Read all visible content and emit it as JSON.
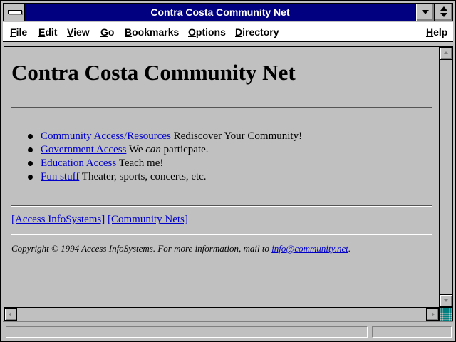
{
  "window": {
    "title": "Contra Costa Community Net"
  },
  "menubar": {
    "items": [
      "File",
      "Edit",
      "View",
      "Go",
      "Bookmarks",
      "Options",
      "Directory"
    ],
    "help": "Help"
  },
  "page": {
    "heading": "Contra Costa Community Net",
    "list": [
      {
        "link": "Community Access/Resources",
        "text_before_em": " Rediscover Your Community!",
        "em": "",
        "text_after_em": ""
      },
      {
        "link": "Government Access",
        "text_before_em": " We ",
        "em": "can",
        "text_after_em": " particpate."
      },
      {
        "link": "Education Access",
        "text_before_em": " Teach me!",
        "em": "",
        "text_after_em": ""
      },
      {
        "link": "Fun stuff",
        "text_before_em": " Theater, sports, concerts, etc.",
        "em": "",
        "text_after_em": ""
      }
    ],
    "nav": {
      "link1": "[Access InfoSystems]",
      "link2": "[Community Nets]"
    },
    "footer": {
      "text": "Copyright © 1994 Access InfoSystems. For more information, mail to ",
      "email": "info@community.net",
      "end": "."
    }
  },
  "statusbar": {
    "text": ""
  },
  "icons": {
    "system_menu": "system-menu-icon",
    "minimize": "minimize-icon",
    "restore": "restore-icon",
    "scroll_up": "scroll-up-icon",
    "scroll_down": "scroll-down-icon",
    "scroll_left": "scroll-left-icon",
    "scroll_right": "scroll-right-icon"
  },
  "colors": {
    "title_bar": "#000080",
    "link": "#0000c8",
    "background": "#c0c0c0"
  }
}
